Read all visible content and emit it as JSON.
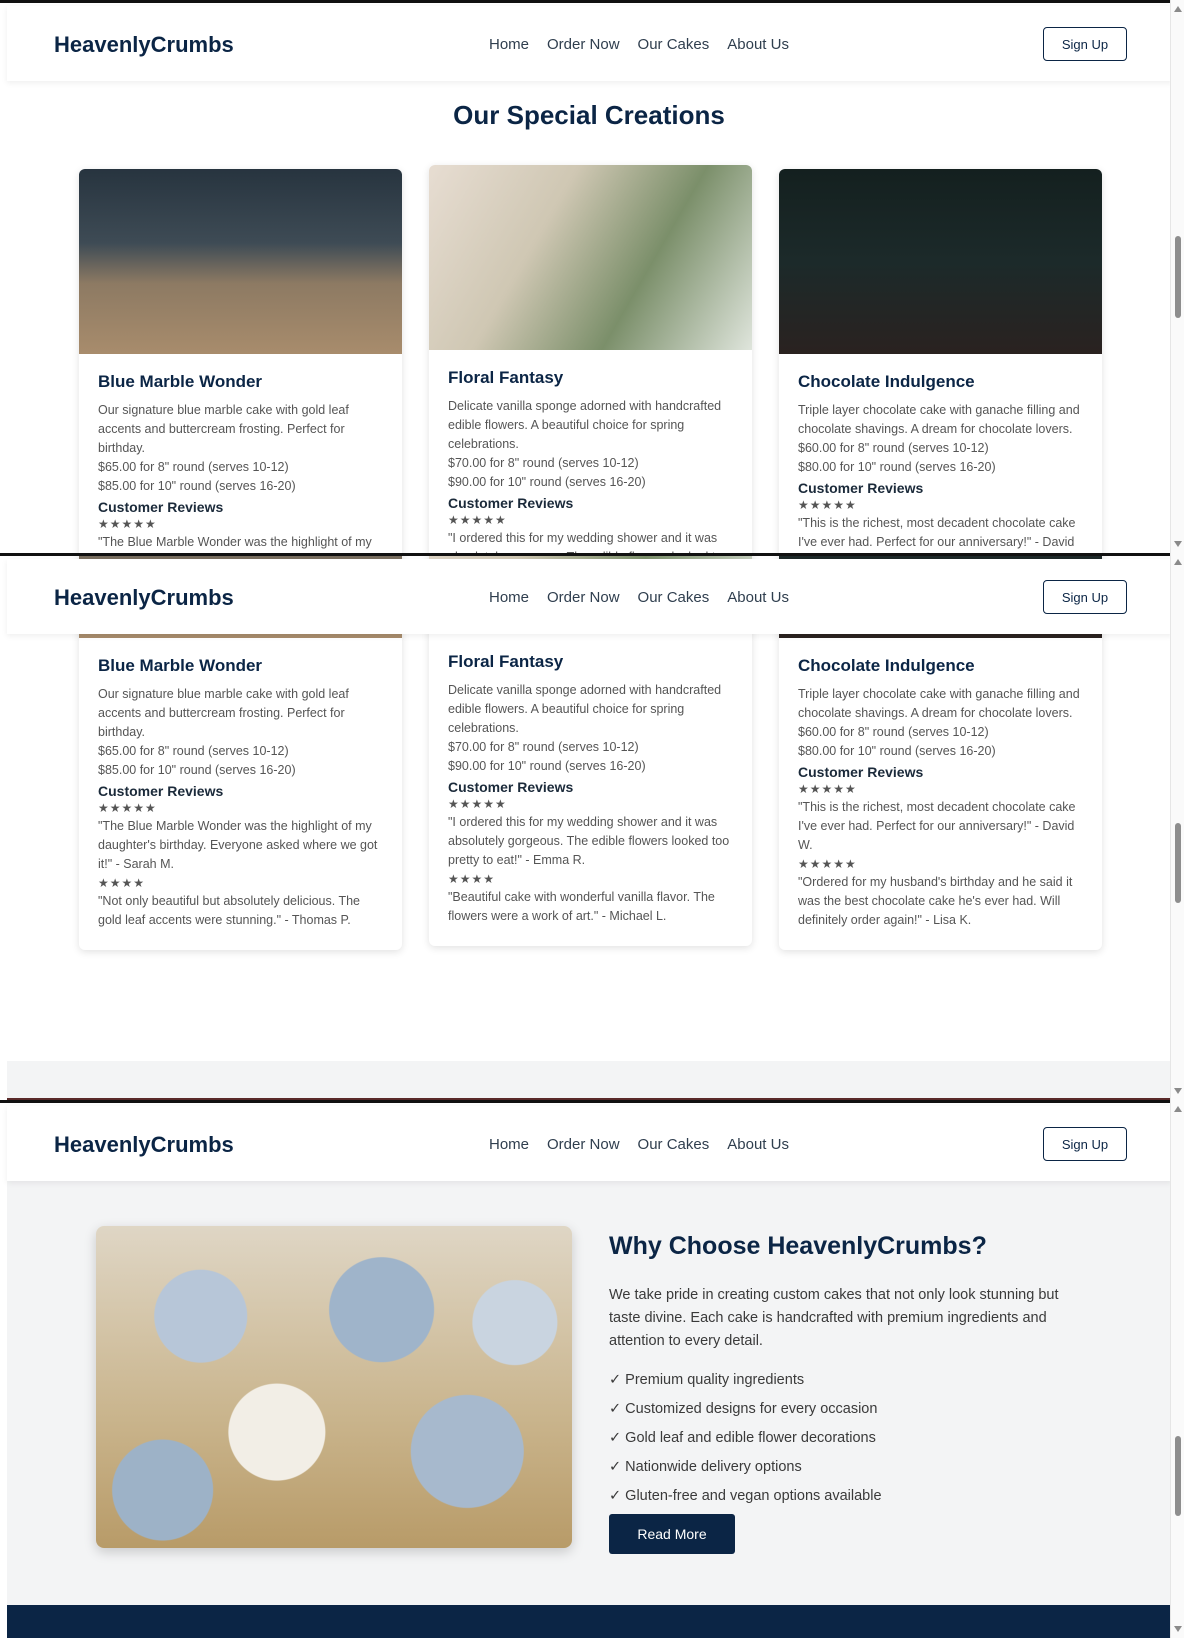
{
  "nav": {
    "brand": "HeavenlyCrumbs",
    "links": [
      "Home",
      "Order Now",
      "Our Cakes",
      "About Us"
    ],
    "signup": "Sign Up"
  },
  "creations": {
    "title": "Our Special Creations",
    "reviews_title": "Customer Reviews",
    "cards": [
      {
        "title": "Blue Marble Wonder",
        "desc": "Our signature blue marble cake with gold leaf accents and buttercream frosting. Perfect for birthday.",
        "price1": "$65.00 for 8\" round (serves 10-12)",
        "price2": "$85.00 for 10\" round (serves 16-20)",
        "reviews": [
          {
            "stars": "★★★★★",
            "text": "\"The Blue Marble Wonder was the highlight of my daughter's birthday. Everyone asked where we got it!\" - Sarah M."
          },
          {
            "stars": "★★★★",
            "text": "\"Not only beautiful but absolutely delicious. The gold leaf accents were stunning.\" - Thomas P."
          }
        ]
      },
      {
        "title": "Floral Fantasy",
        "desc": "Delicate vanilla sponge adorned with handcrafted edible flowers. A beautiful choice for spring celebrations.",
        "price1": "$70.00 for 8\" round (serves 10-12)",
        "price2": "$90.00 for 10\" round (serves 16-20)",
        "reviews": [
          {
            "stars": "★★★★★",
            "text": "\"I ordered this for my wedding shower and it was absolutely gorgeous. The edible flowers looked too pretty to eat!\" - Emma R."
          },
          {
            "stars": "★★★★",
            "text": "\"Beautiful cake with wonderful vanilla flavor. The flowers were a work of art.\" - Michael L."
          }
        ]
      },
      {
        "title": "Chocolate Indulgence",
        "desc": "Triple layer chocolate cake with ganache filling and chocolate shavings. A dream for chocolate lovers.",
        "price1": "$60.00 for 8\" round (serves 10-12)",
        "price2": "$80.00 for 10\" round (serves 16-20)",
        "reviews": [
          {
            "stars": "★★★★★",
            "text": "\"This is the richest, most decadent chocolate cake I've ever had. Perfect for our anniversary!\" - David W."
          },
          {
            "stars": "★★★★★",
            "text": "\"Ordered for my husband's birthday and he said it was the best chocolate cake he's ever had. Will definitely order again!\" - Lisa K."
          }
        ]
      }
    ]
  },
  "why": {
    "title": "Why Choose HeavenlyCrumbs?",
    "text": "We take pride in creating custom cakes that not only look stunning but taste divine. Each cake is handcrafted with premium ingredients and attention to every detail.",
    "items": [
      "✓ Premium quality ingredients",
      "✓ Customized designs for every occasion",
      "✓ Gold leaf and edible flower decorations",
      "✓ Nationwide delivery options",
      "✓ Gluten-free and vegan options available"
    ],
    "button": "Read More"
  },
  "colors": {
    "navy": "#0b2545",
    "section_bg": "#f3f4f5"
  }
}
